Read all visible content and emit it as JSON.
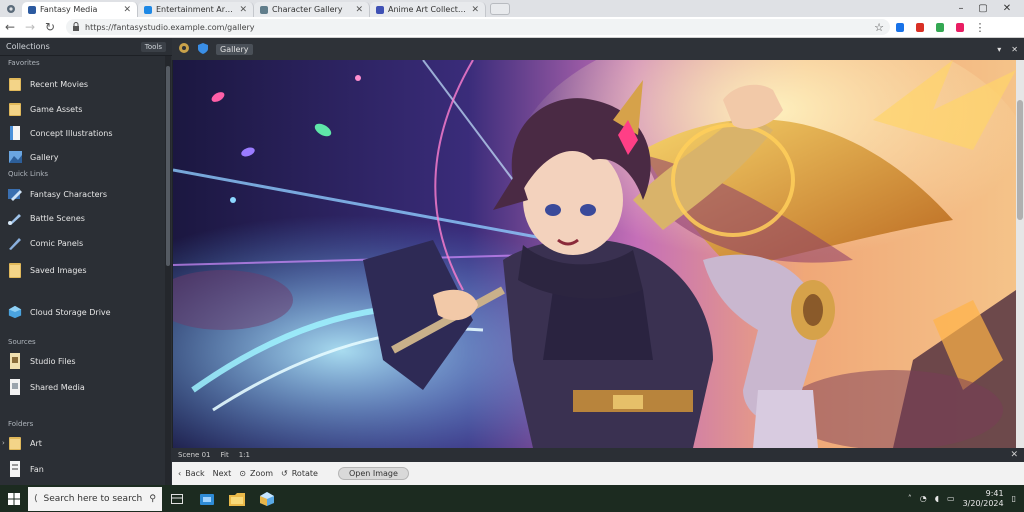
{
  "browser": {
    "tabs": [
      {
        "label": "Fantasy Media",
        "active": true,
        "favicon_color": "#2c5aa0"
      },
      {
        "label": "Entertainment Archives",
        "active": false,
        "favicon_color": "#1e88e5"
      },
      {
        "label": "Character Gallery",
        "active": false,
        "favicon_color": "#607d8b"
      },
      {
        "label": "Anime Art Collection",
        "active": false,
        "favicon_color": "#3f51b5"
      }
    ],
    "address": "https://fantasystudio.example.com/gallery"
  },
  "sidebar": {
    "header": "Collections",
    "header_pill": "Tools",
    "sections": [
      {
        "title": "Favorites"
      },
      {
        "title": "Quick Links"
      },
      {
        "title": "Sources"
      },
      {
        "title": "Folders"
      }
    ],
    "items": [
      {
        "label": "Recent Movies",
        "icon": "folder-icon"
      },
      {
        "label": "Game Assets",
        "icon": "folder-icon"
      },
      {
        "label": "Concept Illustrations",
        "icon": "document-icon"
      },
      {
        "label": "Gallery",
        "icon": "image-icon"
      },
      {
        "label": "Fantasy Characters",
        "icon": "pen-icon"
      },
      {
        "label": "Battle Scenes",
        "icon": "brush-icon"
      },
      {
        "label": "Comic Panels",
        "icon": "brush-icon"
      },
      {
        "label": "Saved Images",
        "icon": "folder-icon"
      },
      {
        "label": "Cloud Storage Drive",
        "icon": "cube-icon"
      },
      {
        "label": "Studio Files",
        "icon": "document-icon"
      },
      {
        "label": "Shared Media",
        "icon": "document-icon"
      },
      {
        "label": "Art",
        "icon": "folder-icon"
      },
      {
        "label": "Fan",
        "icon": "document-icon"
      }
    ]
  },
  "viewer": {
    "tab_label": "Gallery",
    "status_items": [
      "Scene 01",
      "Fit",
      "1:1"
    ],
    "bottom": {
      "back": "Back",
      "next": "Next",
      "zoom_label": "Zoom",
      "rotate_label": "Rotate",
      "open_button": "Open Image"
    }
  },
  "taskbar": {
    "search_placeholder": "Search here to search",
    "time": "9:41",
    "date": "3/20/2024"
  },
  "colors": {
    "accent": "#1a73e8",
    "taskbar": "#1c2b20",
    "sidebar": "#2b2f35"
  }
}
